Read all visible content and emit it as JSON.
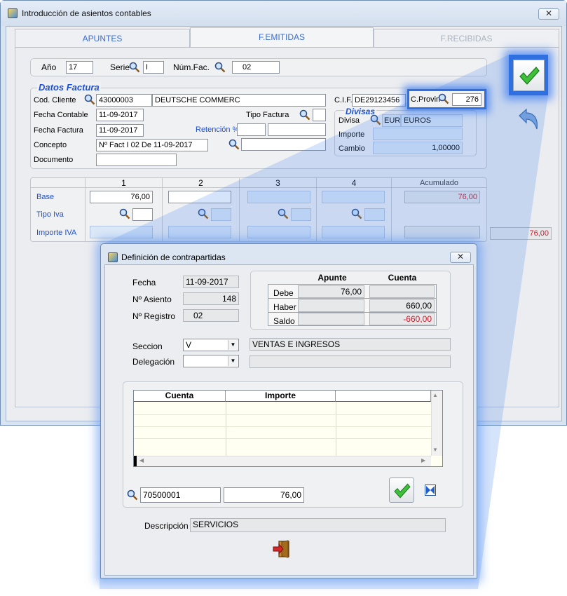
{
  "window": {
    "title": "Introducción de asientos contables",
    "close": "✕"
  },
  "tabs": [
    {
      "label": "APUNTES"
    },
    {
      "label": "F.EMITIDAS"
    },
    {
      "label": "F.RECIBIDAS"
    }
  ],
  "top": {
    "anio_label": "Año",
    "anio": "17",
    "serie_label": "Serie",
    "serie": "I",
    "numfac_label": "Núm.Fac.",
    "numfac": "02"
  },
  "datos": {
    "legend": "Datos Factura",
    "cod_cliente_label": "Cod. Cliente",
    "cod_cliente": "43000003",
    "cliente_nombre": "DEUTSCHE COMMERC",
    "cif_label": "C.I.F.",
    "cif": "DE29123456",
    "cprovin_label": "C.Provin",
    "cprovin": "276",
    "fecha_contable_label": "Fecha Contable",
    "fecha_contable": "11-09-2017",
    "tipo_factura_label": "Tipo Factura",
    "tipo_factura": "",
    "fecha_factura_label": "Fecha Factura",
    "fecha_factura": "11-09-2017",
    "retencion_label": "Retención %",
    "retencion": "",
    "retencion2": "",
    "concepto_label": "Concepto",
    "concepto": "Nº Fact I 02 De 11-09-2017",
    "concepto2": "",
    "documento_label": "Documento",
    "documento": ""
  },
  "divisas": {
    "legend": "Divisas",
    "divisa_label": "Divisa",
    "divisa_code": "EUR",
    "divisa_name": "EUROS",
    "importe_label": "Importe",
    "importe": "",
    "cambio_label": "Cambio",
    "cambio": "1,00000"
  },
  "iva": {
    "cols": [
      "1",
      "2",
      "3",
      "4",
      "Acumulado"
    ],
    "base_label": "Base",
    "base": "76,00",
    "base_acum": "76,00",
    "tipo_label": "Tipo Iva",
    "importe_label": "Importe IVA",
    "importe_total": "76,00"
  },
  "dialog": {
    "title": "Definición de contrapartidas",
    "close": "✕",
    "fecha_label": "Fecha",
    "fecha": "11-09-2017",
    "asiento_label": "Nº Asiento",
    "asiento": "148",
    "registro_label": "Nº Registro",
    "registro": "02",
    "summary_headers": [
      "Apunte",
      "Cuenta"
    ],
    "debe_label": "Debe",
    "debe_apunte": "76,00",
    "debe_cuenta": "",
    "haber_label": "Haber",
    "haber_apunte": "",
    "haber_cuenta": "660,00",
    "saldo_label": "Saldo",
    "saldo_apunte": "",
    "saldo_cuenta": "-660,00",
    "seccion_label": "Seccion",
    "seccion": "V",
    "seccion_desc": "VENTAS  E INGRESOS",
    "delegacion_label": "Delegación",
    "delegacion": "",
    "delegacion_desc": "",
    "grid_headers": [
      "Cuenta",
      "Importe"
    ],
    "cuenta_input": "70500001",
    "importe_input": "76,00",
    "descripcion_label": "Descripción",
    "descripcion": "SERVICIOS"
  },
  "colors": {
    "accent": "#1d4fd3",
    "negative": "#d3182a",
    "ok_green": "#1f9a2a",
    "glow": "#2f6fe0"
  }
}
